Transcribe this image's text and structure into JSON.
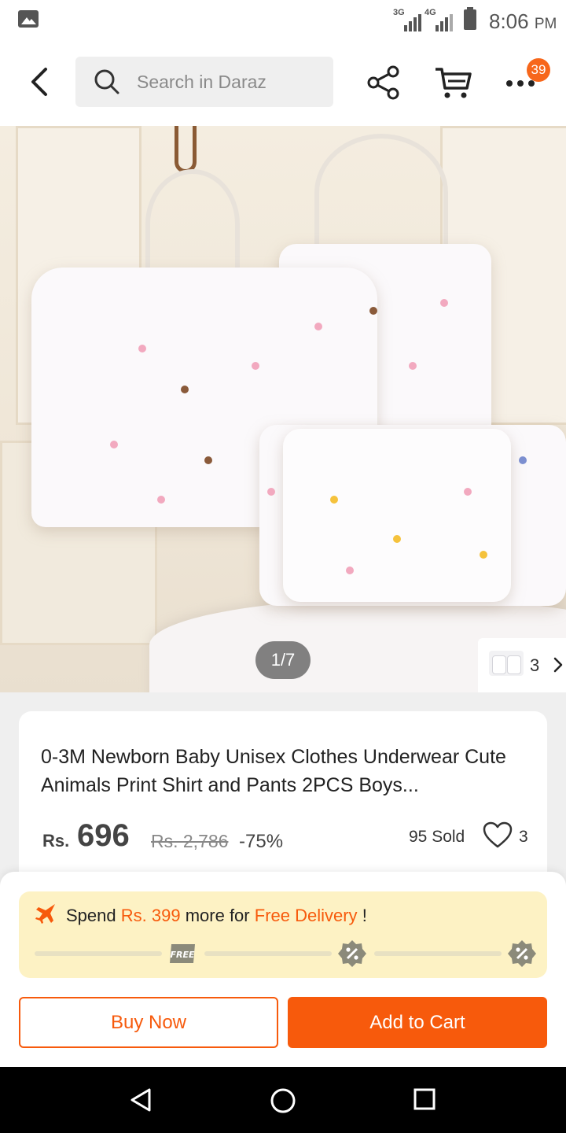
{
  "status_bar": {
    "network_1": "3G",
    "network_2": "4G",
    "time": "8:06",
    "ampm": "PM"
  },
  "top_nav": {
    "search_placeholder": "Search in Daraz",
    "cart_badge": "39",
    "icons": [
      "back-arrow-icon",
      "search-icon",
      "share-icon",
      "cart-icon",
      "more-icon"
    ]
  },
  "gallery": {
    "pager": "1/7",
    "variant_count": "3"
  },
  "product": {
    "title": "0-3M Newborn Baby Unisex Clothes Underwear Cute Animals Print Shirt and Pants 2PCS Boys...",
    "currency": "Rs.",
    "price": "696",
    "original_price": "Rs. 2,786",
    "discount": "-75%",
    "sold": "95 Sold",
    "wishlist_count": "3"
  },
  "promo": {
    "prefix": "Spend",
    "amount": "Rs. 399",
    "middle": "more for",
    "highlight": "Free Delivery",
    "suffix": "!",
    "free_tag": "FREE"
  },
  "actions": {
    "buy_now": "Buy Now",
    "add_to_cart": "Add to Cart"
  },
  "colors": {
    "accent": "#f75a0c",
    "badge": "#f7671b",
    "promo_bg": "#fdf2c4"
  }
}
